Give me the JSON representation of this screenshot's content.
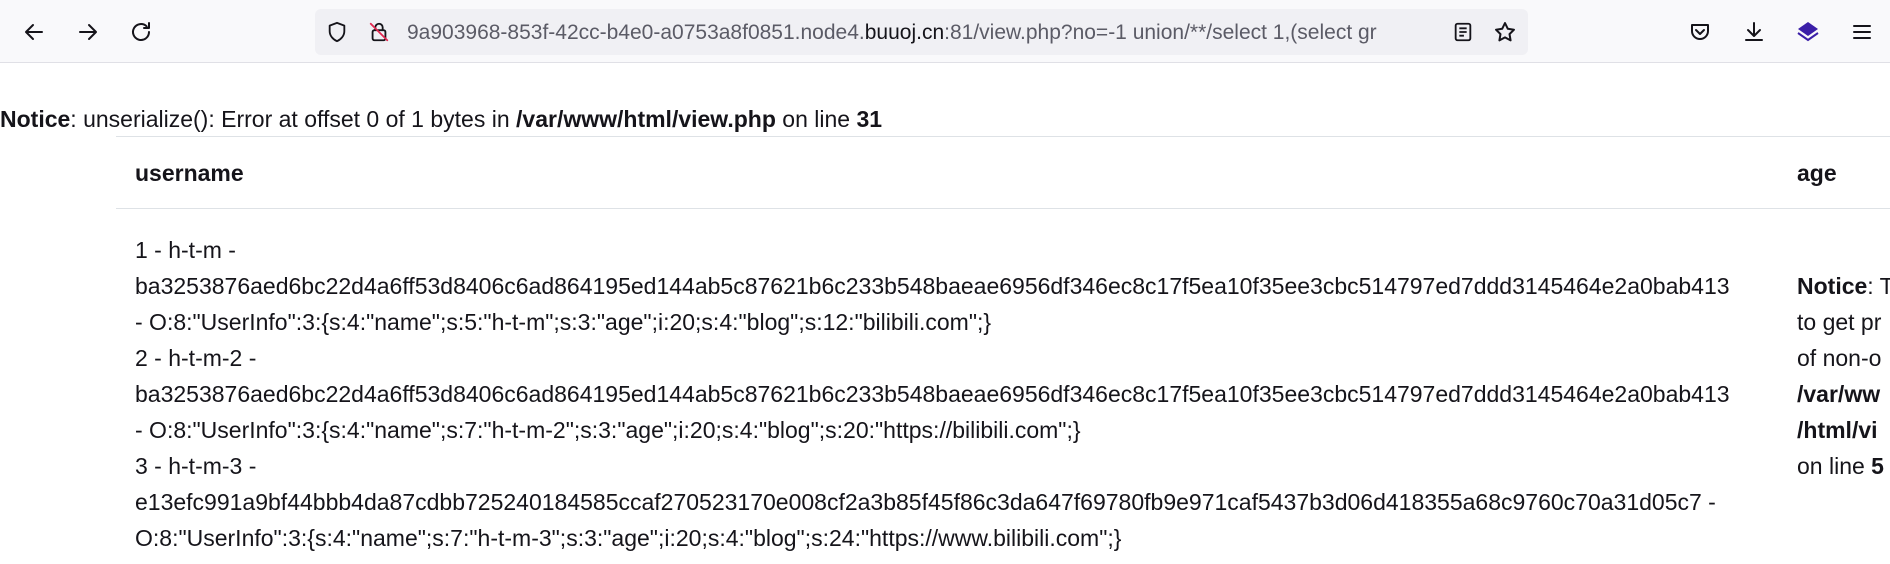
{
  "browser": {
    "url_prefix": "9a903968-853f-42cc-b4e0-a0753a8f0851.node4.",
    "url_domain": "buuoj.cn",
    "url_suffix": ":81/view.php?no=-1 union/**/select 1,(select gr"
  },
  "notice": {
    "label": "Notice",
    "message": ": unserialize(): Error at offset 0 of 1 bytes in ",
    "file": "/var/www/html/view.php",
    "on_line": " on line ",
    "line": "31"
  },
  "table": {
    "headers": [
      "username",
      "age"
    ],
    "username_lines": [
      "1 - h-t-m -",
      "ba3253876aed6bc22d4a6ff53d8406c6ad864195ed144ab5c87621b6c233b548baeae6956df346ec8c17f5ea10f35ee3cbc514797ed7ddd3145464e2a0bab413",
      "- O:8:\"UserInfo\":3:{s:4:\"name\";s:5:\"h-t-m\";s:3:\"age\";i:20;s:4:\"blog\";s:12:\"bilibili.com\";}",
      "2 - h-t-m-2 -",
      "ba3253876aed6bc22d4a6ff53d8406c6ad864195ed144ab5c87621b6c233b548baeae6956df346ec8c17f5ea10f35ee3cbc514797ed7ddd3145464e2a0bab413",
      "- O:8:\"UserInfo\":3:{s:4:\"name\";s:7:\"h-t-m-2\";s:3:\"age\";i:20;s:4:\"blog\";s:20:\"https://bilibili.com\";}",
      "3 - h-t-m-3 -",
      "e13efc991a9bf44bbb4da87cdbb725240184585ccaf270523170e008cf2a3b85f45f86c3da647f69780fb9e971caf5437b3d06d418355a68c9760c70a31d05c7 -",
      "O:8:\"UserInfo\":3:{s:4:\"name\";s:7:\"h-t-m-3\";s:3:\"age\";i:20;s:4:\"blog\";s:24:\"https://www.bilibili.com\";}"
    ],
    "age_notice": {
      "label": "Notice",
      "line1_rest": ": T",
      "line2": "to get pr",
      "line3": "of non-o",
      "line4": "/var/ww",
      "line5": "/html/vi",
      "line6_text": "on line ",
      "line6_num": "5"
    }
  },
  "icons": {
    "back": "arrow-left-icon",
    "forward": "arrow-right-icon",
    "reload": "reload-icon",
    "shield": "tracking-shield-icon",
    "insecure": "insecure-lock-icon",
    "reader": "reader-view-icon",
    "bookmark": "star-icon",
    "pocket": "pocket-icon",
    "download": "download-icon",
    "extension": "extension-icon",
    "menu": "hamburger-menu-icon"
  },
  "colors": {
    "toolbar_bg": "#f9f9fb",
    "urlbar_bg": "#f0f0f4",
    "extension": "#3b1fa8",
    "insecure": "#e22850"
  }
}
